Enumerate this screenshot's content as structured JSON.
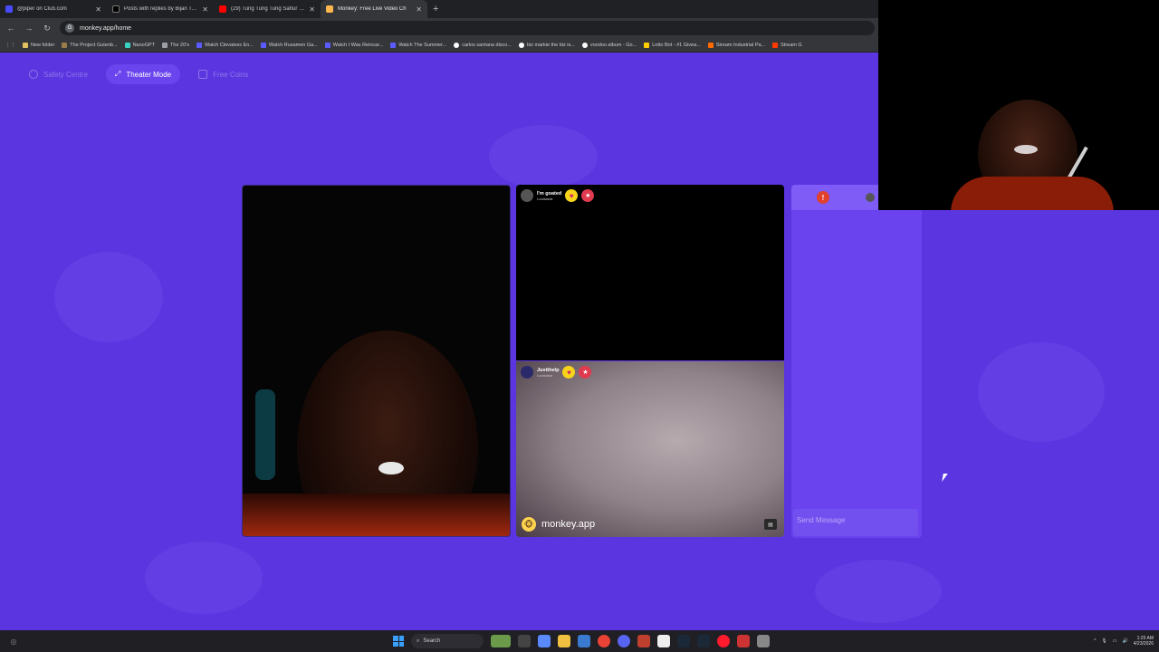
{
  "browser": {
    "tabs": [
      {
        "title": "@piper on Club.com",
        "color": "#4a4aff",
        "active": false
      },
      {
        "title": "Posts with replies by Bijan Tehr",
        "color": "#000000",
        "active": false
      },
      {
        "title": "(29) Tung Tung Tung Sahur - R",
        "color": "#ff0000",
        "active": false
      },
      {
        "title": "Monkey: Free Live Video Ch",
        "color": "#ffb74d",
        "active": true
      }
    ],
    "new_tab": "+",
    "url": "monkey.app/home",
    "bookmarks": [
      {
        "label": "New folder",
        "color": "#e0c060"
      },
      {
        "label": "The Project Gutenb...",
        "color": "#9a7c4a"
      },
      {
        "label": "NanoGPT",
        "color": "#3ad0c0"
      },
      {
        "label": "The 20's",
        "color": "#9aa0a6"
      },
      {
        "label": "Watch Clevatess En...",
        "color": "#5b5bff"
      },
      {
        "label": "Watch Rusamen Ga...",
        "color": "#5b5bff"
      },
      {
        "label": "Watch I Was Reincar...",
        "color": "#5b5bff"
      },
      {
        "label": "Watch The Summer...",
        "color": "#5b5bff"
      },
      {
        "label": "carlos santana disco...",
        "color": "#ffffff"
      },
      {
        "label": "biz markie the biz is...",
        "color": "#ffffff"
      },
      {
        "label": "voodoo album - Go...",
        "color": "#ffffff"
      },
      {
        "label": "Lotto Bot - #1 Givea...",
        "color": "#ffcc00"
      },
      {
        "label": "Stream Industrial Pa...",
        "color": "#ff6a00"
      },
      {
        "label": "Stream G",
        "color": "#ff3a00"
      }
    ]
  },
  "page": {
    "top_buttons": [
      {
        "label": "Safety Centre",
        "active": false
      },
      {
        "label": "Theater Mode",
        "active": true
      },
      {
        "label": "Free Coins",
        "active": false
      }
    ],
    "remote_user_1": {
      "name": "I'm goated",
      "location": "Louisiana"
    },
    "remote_user_2": {
      "name": "Justthelp",
      "location": "Louisiana"
    },
    "brand": "monkey.app",
    "chat_placeholder": "Send Message"
  },
  "taskbar": {
    "search": "Search",
    "time": "1:25 AM",
    "date": "4/23/2026"
  }
}
